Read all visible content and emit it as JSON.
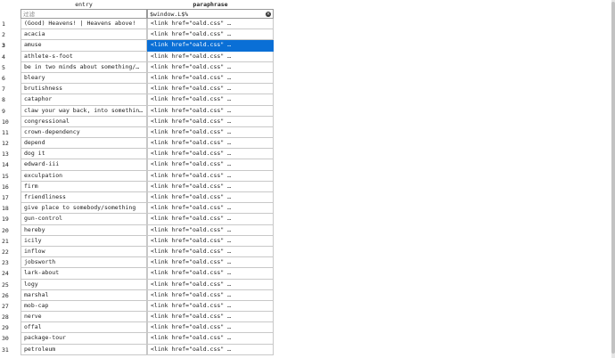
{
  "headers": {
    "entry": "entry",
    "paraphrase": "paraphrase"
  },
  "filters": {
    "entry_placeholder": "过滤",
    "paraphrase_value": "$window.L$%"
  },
  "selected_row": 3,
  "rows": [
    {
      "num": "1",
      "entry": "(Good) Heavens! | Heavens above!",
      "paraphrase": "<link href=\"oald.css\" …"
    },
    {
      "num": "2",
      "entry": "acacia",
      "paraphrase": "<link href=\"oald.css\" …"
    },
    {
      "num": "3",
      "entry": "amuse",
      "paraphrase": "<link href=\"oald.css\" …"
    },
    {
      "num": "4",
      "entry": "athlete-s-foot",
      "paraphrase": "<link href=\"oald.css\" …"
    },
    {
      "num": "5",
      "entry": "be in two minds about something/…",
      "paraphrase": "<link href=\"oald.css\" …"
    },
    {
      "num": "6",
      "entry": "bleary",
      "paraphrase": "<link href=\"oald.css\" …"
    },
    {
      "num": "7",
      "entry": "brutishness",
      "paraphrase": "<link href=\"oald.css\" …"
    },
    {
      "num": "8",
      "entry": "cataphor",
      "paraphrase": "<link href=\"oald.css\" …"
    },
    {
      "num": "9",
      "entry": "claw your way back, into something,…",
      "paraphrase": "<link href=\"oald.css\" …"
    },
    {
      "num": "10",
      "entry": "congressional",
      "paraphrase": "<link href=\"oald.css\" …"
    },
    {
      "num": "11",
      "entry": "crown-dependency",
      "paraphrase": "<link href=\"oald.css\" …"
    },
    {
      "num": "12",
      "entry": "depend",
      "paraphrase": "<link href=\"oald.css\" …"
    },
    {
      "num": "13",
      "entry": "dog it",
      "paraphrase": "<link href=\"oald.css\" …"
    },
    {
      "num": "14",
      "entry": "edward-iii",
      "paraphrase": "<link href=\"oald.css\" …"
    },
    {
      "num": "15",
      "entry": "exculpation",
      "paraphrase": "<link href=\"oald.css\" …"
    },
    {
      "num": "16",
      "entry": "firm",
      "paraphrase": "<link href=\"oald.css\" …"
    },
    {
      "num": "17",
      "entry": "friendliness",
      "paraphrase": "<link href=\"oald.css\" …"
    },
    {
      "num": "18",
      "entry": "give place to somebody/something",
      "paraphrase": "<link href=\"oald.css\" …"
    },
    {
      "num": "19",
      "entry": "gun-control",
      "paraphrase": "<link href=\"oald.css\" …"
    },
    {
      "num": "20",
      "entry": "hereby",
      "paraphrase": "<link href=\"oald.css\" …"
    },
    {
      "num": "21",
      "entry": "icily",
      "paraphrase": "<link href=\"oald.css\" …"
    },
    {
      "num": "22",
      "entry": "inflow",
      "paraphrase": "<link href=\"oald.css\" …"
    },
    {
      "num": "23",
      "entry": "jobsworth",
      "paraphrase": "<link href=\"oald.css\" …"
    },
    {
      "num": "24",
      "entry": "lark-about",
      "paraphrase": "<link href=\"oald.css\" …"
    },
    {
      "num": "25",
      "entry": "logy",
      "paraphrase": "<link href=\"oald.css\" …"
    },
    {
      "num": "26",
      "entry": "marshal",
      "paraphrase": "<link href=\"oald.css\" …"
    },
    {
      "num": "27",
      "entry": "mob-cap",
      "paraphrase": "<link href=\"oald.css\" …"
    },
    {
      "num": "28",
      "entry": "nerve",
      "paraphrase": "<link href=\"oald.css\" …"
    },
    {
      "num": "29",
      "entry": "offal",
      "paraphrase": "<link href=\"oald.css\" …"
    },
    {
      "num": "30",
      "entry": "package-tour",
      "paraphrase": "<link href=\"oald.css\" …"
    },
    {
      "num": "31",
      "entry": "petroleum",
      "paraphrase": "<link href=\"oald.css\" …"
    }
  ]
}
